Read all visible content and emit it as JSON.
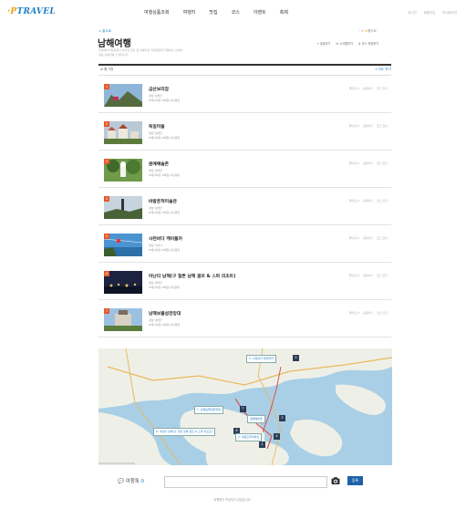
{
  "header": {
    "logo_text": "TRAVEL",
    "nav": [
      "여행상품조회",
      "여행지",
      "맛집",
      "코스",
      "이벤트",
      "축제"
    ],
    "top_links": [
      "로그인",
      "회원가입",
      "마이페이지"
    ]
  },
  "page": {
    "breadcrumb": "< 홈으로",
    "title": "남해여행",
    "description_line1": "한려해상국립공원과 보리암 금산 등 아름다운 자연경관을 자랑하는 남해의",
    "description_line2": "대표 관광지를 소개합니다",
    "like_label": "♡ 0",
    "like_text": "좋아요",
    "share_actions": [
      "공유하기",
      "스크랩하기",
      "코스 저장하기"
    ]
  },
  "list": {
    "total_label": "총 7건",
    "map_toggle_label": "지도 보기",
    "item_actions": [
      "좋아요 0",
      "공유하기",
      "코스 담기"
    ],
    "items": [
      {
        "num": "1",
        "name": "금산보리암",
        "addr": "경남 남해군",
        "tags": "#해수욕장 #체험 #관광지"
      },
      {
        "num": "2",
        "name": "독일마을",
        "addr": "경남 남해군",
        "tags": "#해수욕장 #체험 #관광지"
      },
      {
        "num": "3",
        "name": "원예예술촌",
        "addr": "경남 남해군",
        "tags": "#해수욕장 #체험 #관광지"
      },
      {
        "num": "4",
        "name": "바람흔적미술관",
        "addr": "경남 남해군",
        "tags": "#해수욕장 #체험 #관광지"
      },
      {
        "num": "5",
        "name": "사천바다 케이블카",
        "addr": "경남 사천시",
        "tags": "#해수욕장 #체험 #관광지"
      },
      {
        "num": "6",
        "name": "아난티 남해(구 힐튼 남해 골프 & 스파 리조트)",
        "addr": "경남 남해군",
        "tags": "#해수욕장 #체험 #관광지"
      },
      {
        "num": "7",
        "name": "남해보물섬전망대",
        "addr": "경남 남해군",
        "tags": "#해수욕장 #체험 #관광지"
      }
    ]
  },
  "map": {
    "pins": [
      {
        "label": "5. 사천바다 케이블카",
        "num": "5"
      },
      {
        "label": "7. 남해보물섬전망대",
        "num": "7"
      },
      {
        "label": "원예예술촌",
        "num": "3"
      },
      {
        "label": "6. 아난티 남해(구 힐튼 남해 골프 & 스파 리조트)",
        "num": "6"
      },
      {
        "label": "2. 바람흔적미술관",
        "num": "4"
      },
      {
        "label": "",
        "num": "1"
      }
    ],
    "colors": {
      "sea": "#a9cfe6",
      "land": "#eef0e8",
      "road": "#e9b85e",
      "route": "#e0443a"
    }
  },
  "review": {
    "label": "여행톡",
    "count": "0",
    "input_placeholder": "",
    "submit_label": "등록",
    "empty_text": "여행톡이 작성되지 않았습니다."
  }
}
